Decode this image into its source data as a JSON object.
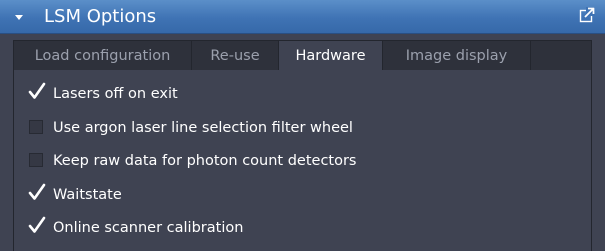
{
  "panel": {
    "title": "LSM Options",
    "collapse_icon": "triangle-down-icon",
    "undock_icon": "undock-arrow-icon"
  },
  "tabs": [
    {
      "label": "Load configuration",
      "active": false
    },
    {
      "label": "Re-use",
      "active": false
    },
    {
      "label": "Hardware",
      "active": true
    },
    {
      "label": "Image display",
      "active": false
    }
  ],
  "options": [
    {
      "label": "Lasers off on exit",
      "checked": true
    },
    {
      "label": "Use argon laser line selection filter wheel",
      "checked": false
    },
    {
      "label": "Keep raw data for photon count detectors",
      "checked": false
    },
    {
      "label": "Waitstate",
      "checked": true
    },
    {
      "label": "Online scanner calibration",
      "checked": true
    }
  ],
  "colors": {
    "title_bar": "#3f73b4",
    "panel_background": "#3f4352",
    "tab_strip": "#2e313b",
    "inactive_tab_text": "#9ba0ad",
    "text": "#ffffff"
  }
}
